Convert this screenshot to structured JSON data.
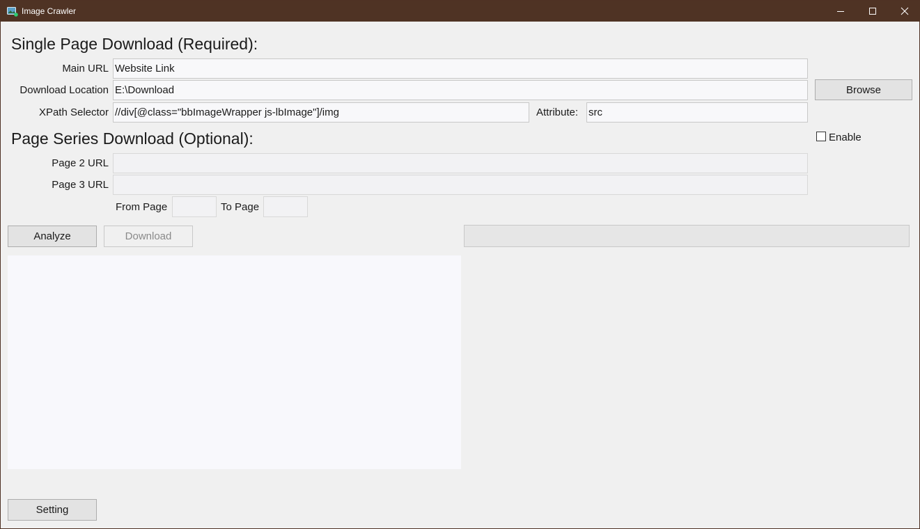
{
  "window": {
    "title": "Image Crawler",
    "titlebar_color": "#4f3324",
    "controls": {
      "minimize_icon": "minimize-icon",
      "maximize_icon": "maximize-icon",
      "close_icon": "close-icon"
    }
  },
  "single_page": {
    "heading": "Single Page Download (Required):",
    "main_url": {
      "label": "Main URL",
      "value": "Website Link"
    },
    "download_location": {
      "label": "Download Location",
      "value": "E:\\Download",
      "browse_label": "Browse"
    },
    "xpath": {
      "label": "XPath Selector",
      "value": "//div[@class=\"bbImageWrapper  js-lbImage\"]/img"
    },
    "attribute": {
      "label": "Attribute:",
      "value": "src"
    }
  },
  "page_series": {
    "heading": "Page Series Download (Optional):",
    "enable": {
      "label": "Enable",
      "checked": false
    },
    "page2_url": {
      "label": "Page 2 URL",
      "value": ""
    },
    "page3_url": {
      "label": "Page 3 URL",
      "value": ""
    },
    "from_page": {
      "label": "From Page",
      "value": ""
    },
    "to_page": {
      "label": "To Page",
      "value": ""
    }
  },
  "actions": {
    "analyze_label": "Analyze",
    "download_label": "Download",
    "download_enabled": false,
    "progress": 0
  },
  "log": {
    "text": ""
  },
  "footer": {
    "setting_label": "Setting"
  }
}
